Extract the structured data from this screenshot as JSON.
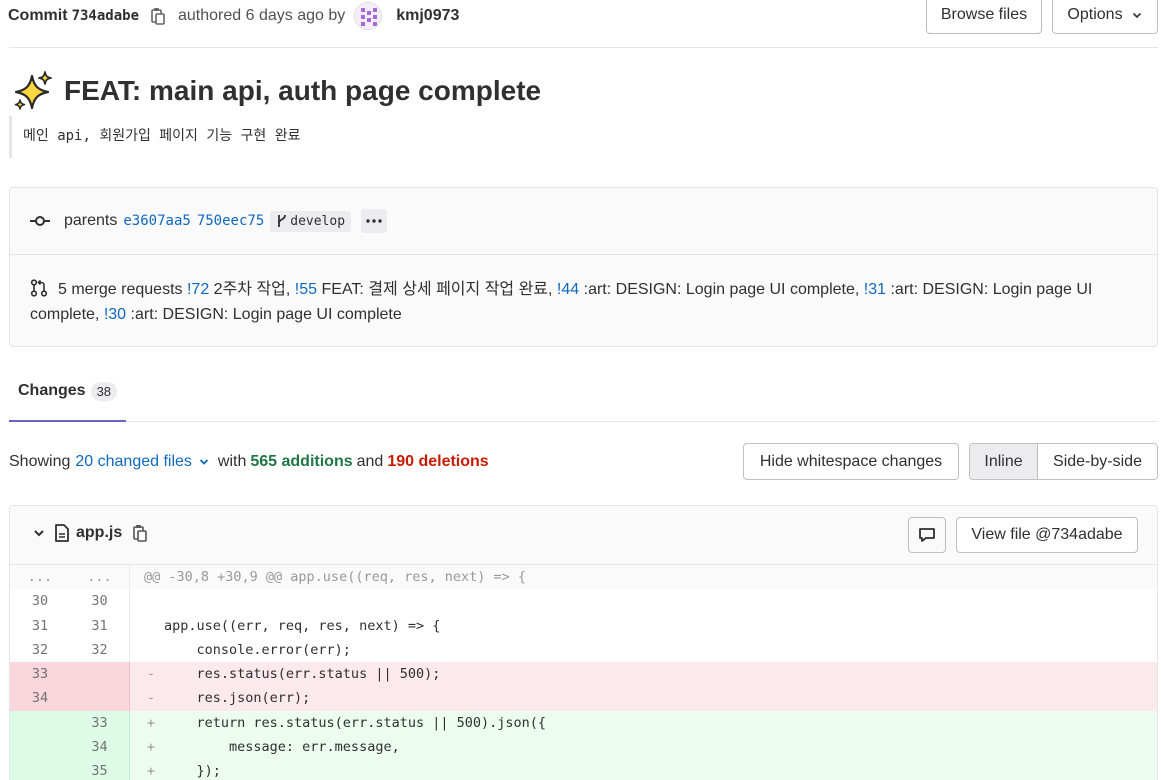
{
  "header": {
    "commit_label": "Commit",
    "commit_sha": "734adabe",
    "authored_text": "authored 6 days ago by",
    "author": "kmj0973",
    "browse_files": "Browse files",
    "options": "Options"
  },
  "commit": {
    "title": "FEAT: main api, auth page complete",
    "description": "메인 api, 회원가입 페이지 기능 구현 완료",
    "parents_label": "parents",
    "parent_shas": [
      "e3607aa5",
      "750eec75"
    ],
    "branch": "develop",
    "merge_requests": {
      "label": "5 merge requests",
      "items": [
        {
          "ref": "!72",
          "title": "2주차 작업,"
        },
        {
          "ref": "!55",
          "title": "FEAT: 결제 상세 페이지 작업 완료,"
        },
        {
          "ref": "!44",
          "title": ":art: DESIGN: Login page UI complete,"
        },
        {
          "ref": "!31",
          "title": ":art: DESIGN: Login page UI complete,"
        },
        {
          "ref": "!30",
          "title": ":art: DESIGN: Login page UI complete"
        }
      ]
    }
  },
  "tabs": {
    "changes_label": "Changes",
    "changes_count": "38"
  },
  "summary": {
    "showing": "Showing",
    "changed_files": "20 changed files",
    "with": "with",
    "additions": "565 additions",
    "and": "and",
    "deletions": "190 deletions",
    "hide_whitespace": "Hide whitespace changes",
    "inline": "Inline",
    "side_by_side": "Side-by-side"
  },
  "file": {
    "name": "app.js",
    "view_file": "View file @734adabe"
  },
  "diff": {
    "hunk_old": "...",
    "hunk_new": "...",
    "hunk_header": "@@ -30,8 +30,9 @@ app.use((req, res, next) => {",
    "lines": [
      {
        "old": "30",
        "new": "30",
        "sign": "",
        "type": "ctx",
        "text": ""
      },
      {
        "old": "31",
        "new": "31",
        "sign": "",
        "type": "ctx",
        "text": "app.use((err, req, res, next) => {"
      },
      {
        "old": "32",
        "new": "32",
        "sign": "",
        "type": "ctx",
        "text": "    console.error(err);"
      },
      {
        "old": "33",
        "new": "",
        "sign": "-",
        "type": "old",
        "text": "    res.status(err.status || 500);"
      },
      {
        "old": "34",
        "new": "",
        "sign": "-",
        "type": "old",
        "text": "    res.json(err);"
      },
      {
        "old": "",
        "new": "33",
        "sign": "+",
        "type": "new",
        "text": "    return res.status(err.status || 500).json({"
      },
      {
        "old": "",
        "new": "34",
        "sign": "+",
        "type": "new",
        "text": "        message: err.message,"
      },
      {
        "old": "",
        "new": "35",
        "sign": "+",
        "type": "new",
        "text": "    });"
      }
    ]
  }
}
